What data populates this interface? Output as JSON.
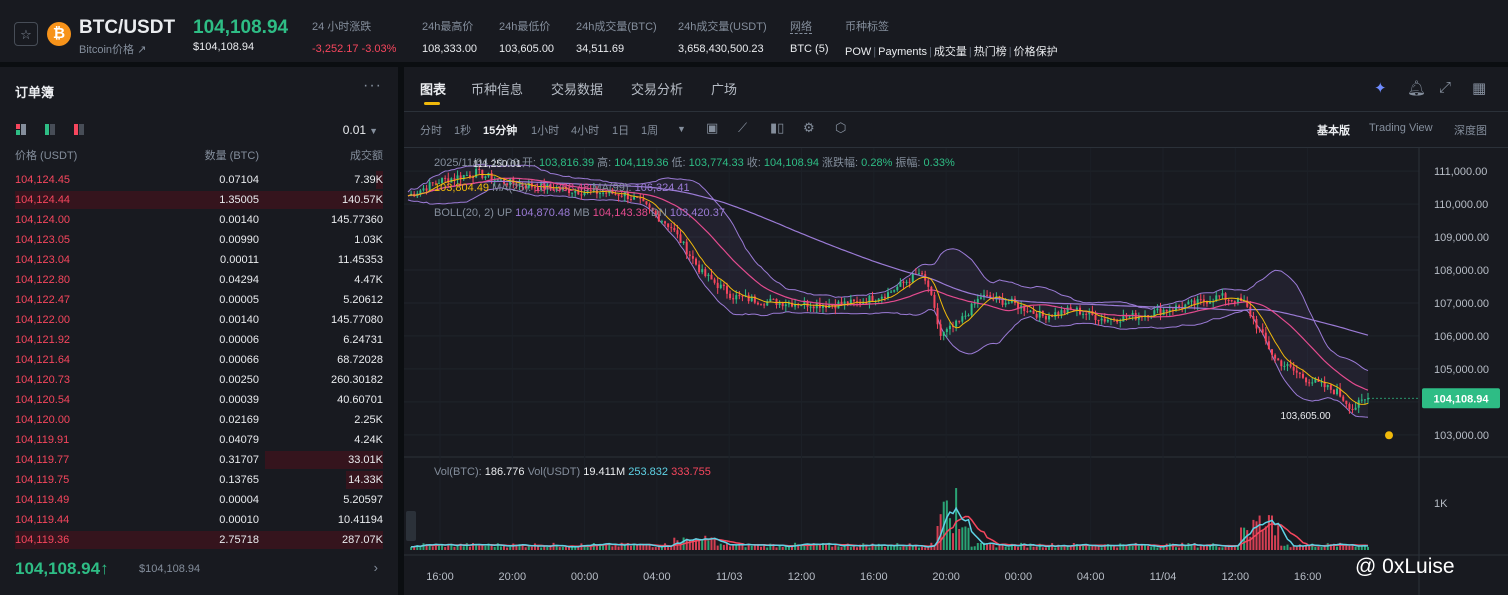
{
  "ticker": {
    "symbol": "BTC/USDT",
    "subtitle": "Bitcoin价格 ↗",
    "last_price": "104,108.94",
    "last_price_usd": "$104,108.94",
    "coin_icon": "bitcoin-icon",
    "star_icon": "star-outline-icon",
    "stats": [
      {
        "label": "24 小时涨跌",
        "value": "-3,252.17 -3.03%",
        "color": "#f6465d"
      },
      {
        "label": "24h最高价",
        "value": "108,333.00"
      },
      {
        "label": "24h最低价",
        "value": "103,605.00"
      },
      {
        "label": "24h成交量(BTC)",
        "value": "34,511.69"
      },
      {
        "label": "24h成交量(USDT)",
        "value": "3,658,430,500.23"
      }
    ],
    "network": {
      "label": "网络",
      "value": "BTC (5)"
    },
    "tags": {
      "label": "币种标签",
      "items": [
        "POW",
        "Payments",
        "成交量",
        "热门榜",
        "价格保护"
      ]
    }
  },
  "orderbook": {
    "title": "订单簿",
    "more": "···",
    "tick_size": "0.01",
    "headers": {
      "price": "价格 (USDT)",
      "qty": "数量 (BTC)",
      "total": "成交额"
    },
    "rows": [
      {
        "price": "104,124.45",
        "qty": "0.07104",
        "total": "7.39K",
        "depth": 0.02
      },
      {
        "price": "104,124.44",
        "qty": "1.35005",
        "total": "140.57K",
        "depth": 1.0
      },
      {
        "price": "104,124.00",
        "qty": "0.00140",
        "total": "145.77360",
        "depth": 0.0
      },
      {
        "price": "104,123.05",
        "qty": "0.00990",
        "total": "1.03K",
        "depth": 0.0
      },
      {
        "price": "104,123.04",
        "qty": "0.00011",
        "total": "11.45353",
        "depth": 0.0
      },
      {
        "price": "104,122.80",
        "qty": "0.04294",
        "total": "4.47K",
        "depth": 0.0
      },
      {
        "price": "104,122.47",
        "qty": "0.00005",
        "total": "5.20612",
        "depth": 0.0
      },
      {
        "price": "104,122.00",
        "qty": "0.00140",
        "total": "145.77080",
        "depth": 0.0
      },
      {
        "price": "104,121.92",
        "qty": "0.00006",
        "total": "6.24731",
        "depth": 0.0
      },
      {
        "price": "104,121.64",
        "qty": "0.00066",
        "total": "68.72028",
        "depth": 0.0
      },
      {
        "price": "104,120.73",
        "qty": "0.00250",
        "total": "260.30182",
        "depth": 0.0
      },
      {
        "price": "104,120.54",
        "qty": "0.00039",
        "total": "40.60701",
        "depth": 0.0
      },
      {
        "price": "104,120.00",
        "qty": "0.02169",
        "total": "2.25K",
        "depth": 0.0
      },
      {
        "price": "104,119.91",
        "qty": "0.04079",
        "total": "4.24K",
        "depth": 0.0
      },
      {
        "price": "104,119.77",
        "qty": "0.31707",
        "total": "33.01K",
        "depth": 0.32
      },
      {
        "price": "104,119.75",
        "qty": "0.13765",
        "total": "14.33K",
        "depth": 0.1
      },
      {
        "price": "104,119.49",
        "qty": "0.00004",
        "total": "5.20597",
        "depth": 0.0
      },
      {
        "price": "104,119.44",
        "qty": "0.00010",
        "total": "10.41194",
        "depth": 0.0
      },
      {
        "price": "104,119.36",
        "qty": "2.75718",
        "total": "287.07K",
        "depth": 1.0
      }
    ],
    "last_price": "104,108.94",
    "last_arrow": "↑",
    "last_price_usd": "$104,108.94"
  },
  "chart_panel": {
    "tabs": [
      "图表",
      "币种信息",
      "交易数据",
      "交易分析",
      "广场"
    ],
    "intervals": [
      "分时",
      "1秒",
      "15分钟",
      "1小时",
      "4小时",
      "1日",
      "1周"
    ],
    "active_interval": "15分钟",
    "views": [
      "基本版",
      "Trading View",
      "深度图"
    ],
    "active_view": "基本版",
    "toolbar_icons": [
      "ai-sparkle-icon",
      "bell-icon",
      "expand-icon",
      "grid-layout-icon"
    ],
    "chart_icons": [
      "calendar-icon",
      "indicator-icon",
      "candle-type-icon",
      "settings-icon",
      "hexagon-icon"
    ]
  },
  "chart_data": {
    "type": "candlestick",
    "ohlc_info": {
      "date": "2025/11/04 19:00",
      "open_label": "开:",
      "open": "103,816.39",
      "high_label": "高:",
      "high": "104,119.36",
      "low_label": "低:",
      "low": "103,774.33",
      "close_label": "收:",
      "close": "104,108.94",
      "change_label": "涨跌幅:",
      "change": "0.28%",
      "amp_label": "振幅:",
      "amp": "0.33%"
    },
    "ma": {
      "ma7": "103,804.49",
      "ma25_label": "MA(25):",
      "ma25": "104,368.48",
      "ma99_label": "MA(99):",
      "ma99": "106,324.41"
    },
    "boll": {
      "label": "BOLL(20, 2)",
      "up_label": "UP",
      "up": "104,870.48",
      "mb_label": "MB",
      "mb": "104,143.38",
      "dn_label": "DN",
      "dn": "103,420.37"
    },
    "y_ticks": [
      "111,000.00",
      "110,000.00",
      "109,000.00",
      "108,000.00",
      "107,000.00",
      "106,000.00",
      "105,000.00",
      "104,000.00",
      "103,000.00"
    ],
    "y_range": [
      102600,
      111550
    ],
    "x_ticks": [
      "16:00",
      "20:00",
      "00:00",
      "04:00",
      "11/03",
      "12:00",
      "16:00",
      "20:00",
      "00:00",
      "04:00",
      "11/04",
      "12:00",
      "16:00"
    ],
    "current_price": "104,108.94",
    "high_mark": "111,250.01",
    "low_mark": "103,605.00",
    "volume": {
      "label": "Vol(BTC):",
      "btc": "186.776",
      "usdt_label": "Vol(USDT)",
      "usdt": "19.411M",
      "ma5": "253.832",
      "ma10": "333.755",
      "y_tick": "1K"
    },
    "close_path": [
      [
        0,
        110250
      ],
      [
        10,
        110700
      ],
      [
        22,
        110950
      ],
      [
        30,
        110700
      ],
      [
        40,
        110550
      ],
      [
        55,
        110400
      ],
      [
        70,
        110300
      ],
      [
        75,
        110050
      ],
      [
        85,
        109300
      ],
      [
        95,
        107900
      ],
      [
        105,
        107200
      ],
      [
        115,
        107050
      ],
      [
        125,
        107000
      ],
      [
        135,
        106950
      ],
      [
        145,
        107000
      ],
      [
        155,
        107300
      ],
      [
        165,
        107900
      ],
      [
        168,
        107500
      ],
      [
        172,
        106000
      ],
      [
        178,
        106400
      ],
      [
        185,
        107200
      ],
      [
        195,
        107000
      ],
      [
        205,
        106600
      ],
      [
        215,
        106800
      ],
      [
        225,
        106500
      ],
      [
        235,
        106600
      ],
      [
        245,
        106800
      ],
      [
        255,
        107000
      ],
      [
        262,
        107200
      ],
      [
        270,
        107000
      ],
      [
        280,
        105300
      ],
      [
        290,
        104700
      ],
      [
        300,
        104300
      ],
      [
        305,
        103800
      ],
      [
        310,
        104108.94
      ]
    ]
  },
  "watermark": "@ 0xLuise",
  "colors": {
    "up": "#2ebd85",
    "down": "#f6465d",
    "accent": "#f0b90b",
    "ma7": "#f0b90b",
    "ma25": "#e44b8f",
    "ma99": "#9b7bd6",
    "boll": "#9b7bd6"
  }
}
